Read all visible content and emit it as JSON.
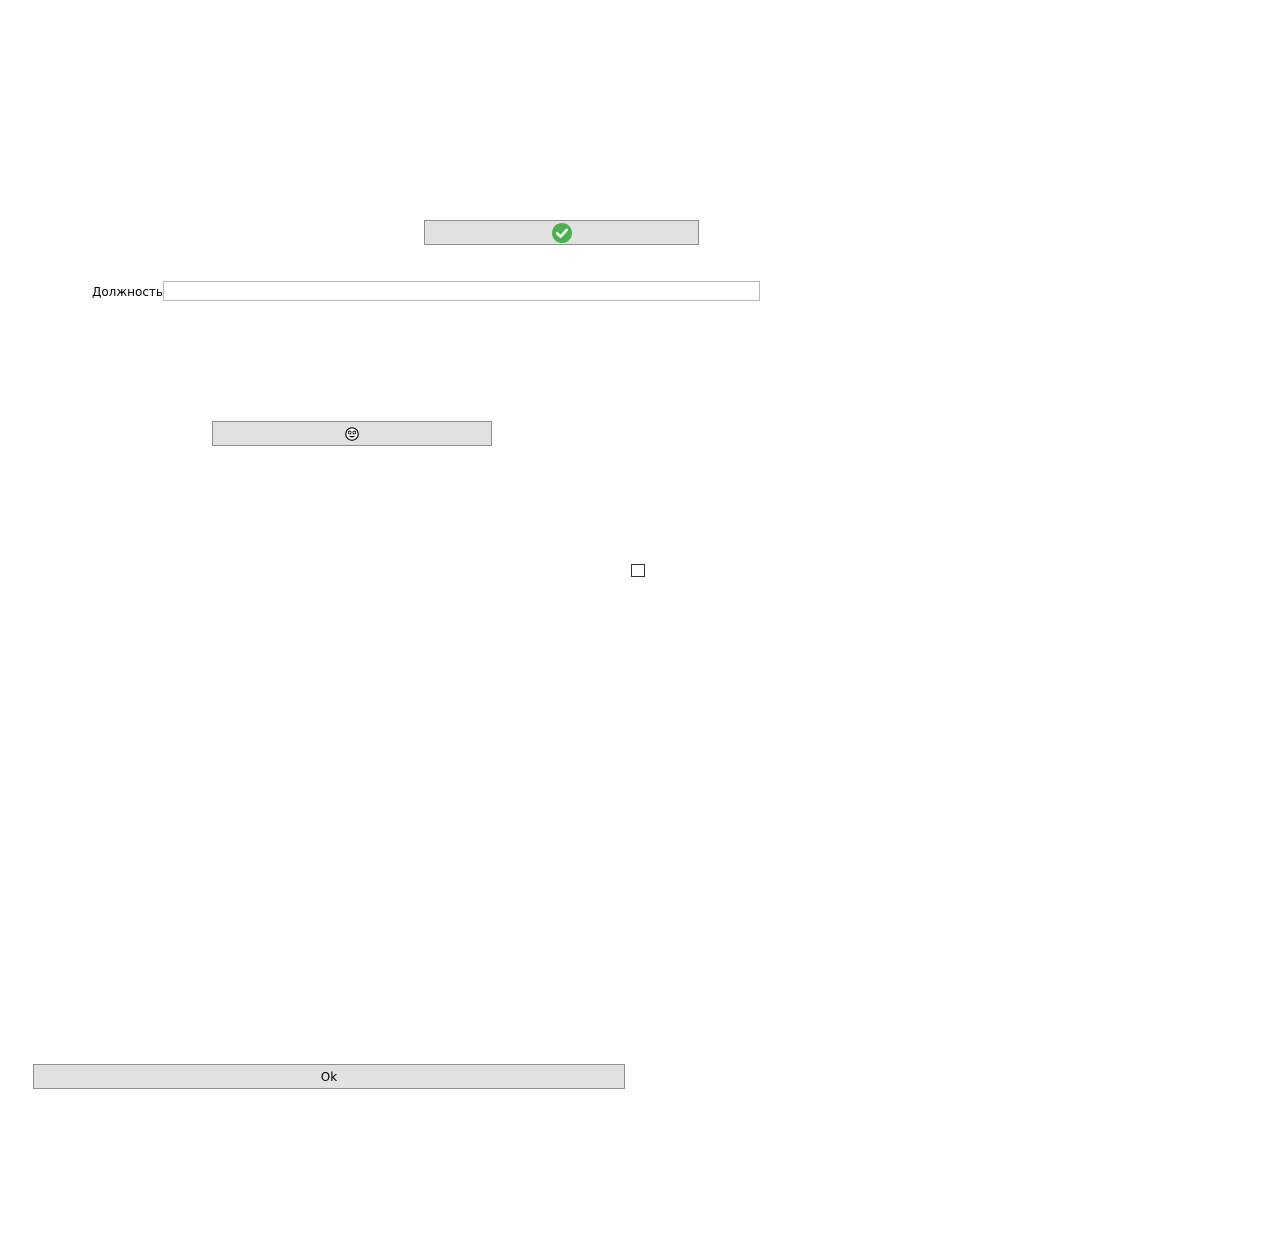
{
  "form": {
    "confirm_button": {
      "icon": "check-circle-icon",
      "icon_color": "#4caf50"
    },
    "position_field": {
      "label": "Должность",
      "value": "",
      "placeholder": ""
    },
    "emoji_button": {
      "icon": "face-emoji-icon"
    },
    "checkbox": {
      "checked": false
    },
    "ok_button": {
      "label": "Ok"
    }
  }
}
